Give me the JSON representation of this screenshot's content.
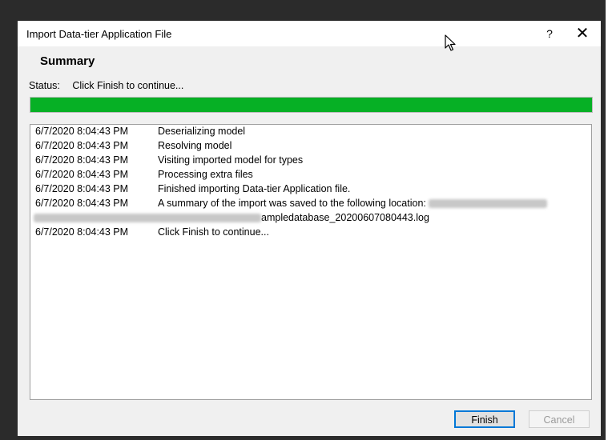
{
  "dialog": {
    "title": "Import Data-tier Application File",
    "help_label": "?",
    "close_label": "✕"
  },
  "summary": {
    "heading": "Summary",
    "status_label": "Status:",
    "status_text": "Click Finish to continue..."
  },
  "progress": {
    "percent": 100,
    "color": "#06b025"
  },
  "log": {
    "rows": [
      {
        "time": "6/7/2020 8:04:43 PM",
        "message": "Deserializing model"
      },
      {
        "time": "6/7/2020 8:04:43 PM",
        "message": "Resolving model"
      },
      {
        "time": "6/7/2020 8:04:43 PM",
        "message": "Visiting imported model for types"
      },
      {
        "time": "6/7/2020 8:04:43 PM",
        "message": "Processing extra files"
      },
      {
        "time": "6/7/2020 8:04:43 PM",
        "message": "Finished importing Data-tier Application file."
      },
      {
        "time": "6/7/2020 8:04:43 PM",
        "message": "A summary of the import was saved to the following location:"
      }
    ],
    "summary_path_tail": "ampledatabase_20200607080443.log",
    "final_row": {
      "time": "6/7/2020 8:04:43 PM",
      "message": "Click Finish to continue..."
    }
  },
  "buttons": {
    "finish": "Finish",
    "cancel": "Cancel"
  }
}
